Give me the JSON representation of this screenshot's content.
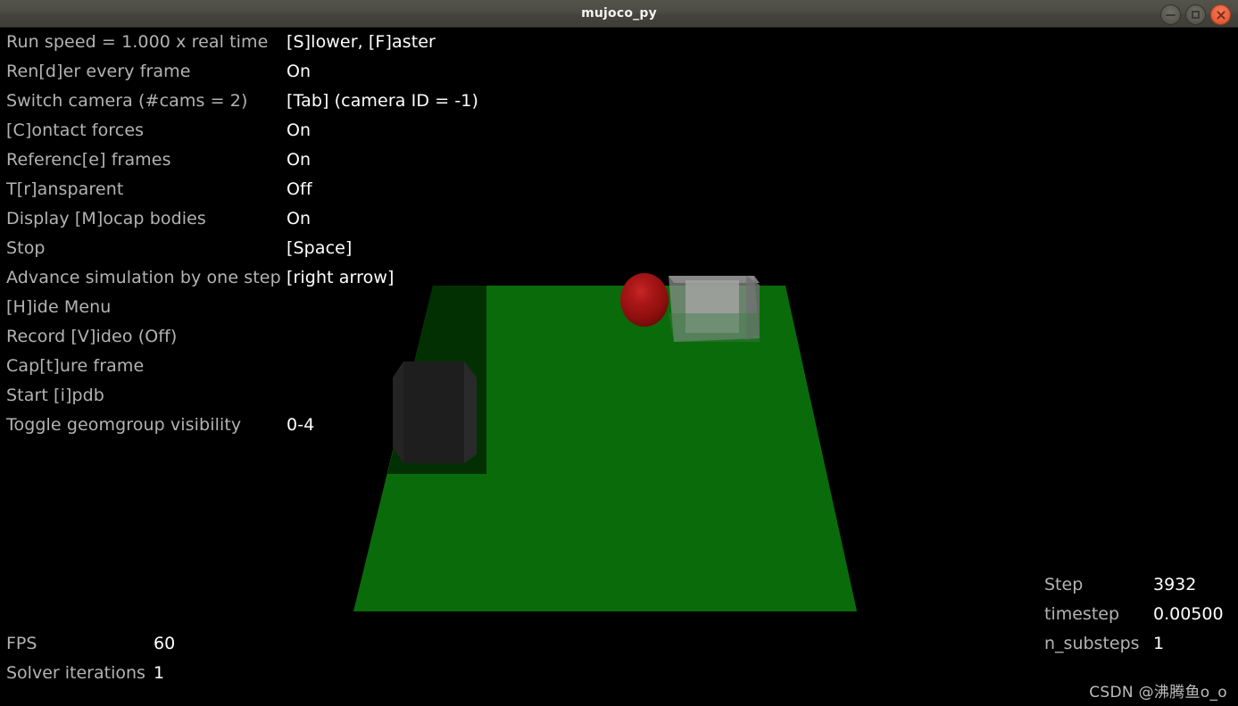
{
  "window": {
    "title": "mujoco_py",
    "buttons": [
      {
        "name": "minimize",
        "glyph": "–"
      },
      {
        "name": "maximize",
        "glyph": "□"
      },
      {
        "name": "close",
        "glyph": "×"
      }
    ]
  },
  "menu": {
    "rows": [
      {
        "label": "Run speed = 1.000 x real time",
        "value": "[S]lower, [F]aster"
      },
      {
        "label": "Ren[d]er every frame",
        "value": "On"
      },
      {
        "label": "Switch camera (#cams = 2)",
        "value": "[Tab] (camera ID = -1)"
      },
      {
        "label": "[C]ontact forces",
        "value": "On"
      },
      {
        "label": "Referenc[e] frames",
        "value": "On"
      },
      {
        "label": "T[r]ansparent",
        "value": "Off"
      },
      {
        "label": "Display [M]ocap bodies",
        "value": "On"
      },
      {
        "label": "Stop",
        "value": "[Space]"
      },
      {
        "label": "Advance simulation by one step",
        "value": "[right arrow]"
      },
      {
        "label": "[H]ide Menu",
        "value": ""
      },
      {
        "label": "Record [V]ideo (Off)",
        "value": ""
      },
      {
        "label": "Cap[t]ure frame",
        "value": ""
      },
      {
        "label": "Start [i]pdb",
        "value": ""
      },
      {
        "label": "Toggle geomgroup visibility",
        "value": "0-4"
      }
    ]
  },
  "stats_bottom_left": [
    {
      "label": "FPS",
      "value": "60"
    },
    {
      "label": "Solver iterations",
      "value": "1"
    }
  ],
  "stats_bottom_right": [
    {
      "label": "Step",
      "value": "3932"
    },
    {
      "label": "timestep",
      "value": "0.00500"
    },
    {
      "label": "n_substeps",
      "value": "1"
    }
  ],
  "watermark": "CSDN @沸腾鱼o_o",
  "scene": {
    "background_color": "#000000",
    "floor_color": "#0a6b0a",
    "floor_shadow_color": "#033003",
    "sphere_color": "#a81414",
    "dark_box_color": "#1e1e1e",
    "mocap_box_color": "#9a9a9a",
    "objects": [
      {
        "name": "ground-plane",
        "type": "plane",
        "color": "#0a6b0a"
      },
      {
        "name": "shadow-region",
        "type": "shadow",
        "color": "#033003"
      },
      {
        "name": "dark-box",
        "type": "box",
        "color": "#1e1e1e"
      },
      {
        "name": "red-sphere",
        "type": "sphere",
        "color": "#a81414"
      },
      {
        "name": "mocap-box",
        "type": "box-transparent",
        "color": "#9a9a9a"
      }
    ]
  },
  "colors": {
    "titlebar": "#4a4a42",
    "close_button": "#e8633f",
    "menu_label": "#b3b3b3",
    "menu_value": "#ffffff"
  }
}
